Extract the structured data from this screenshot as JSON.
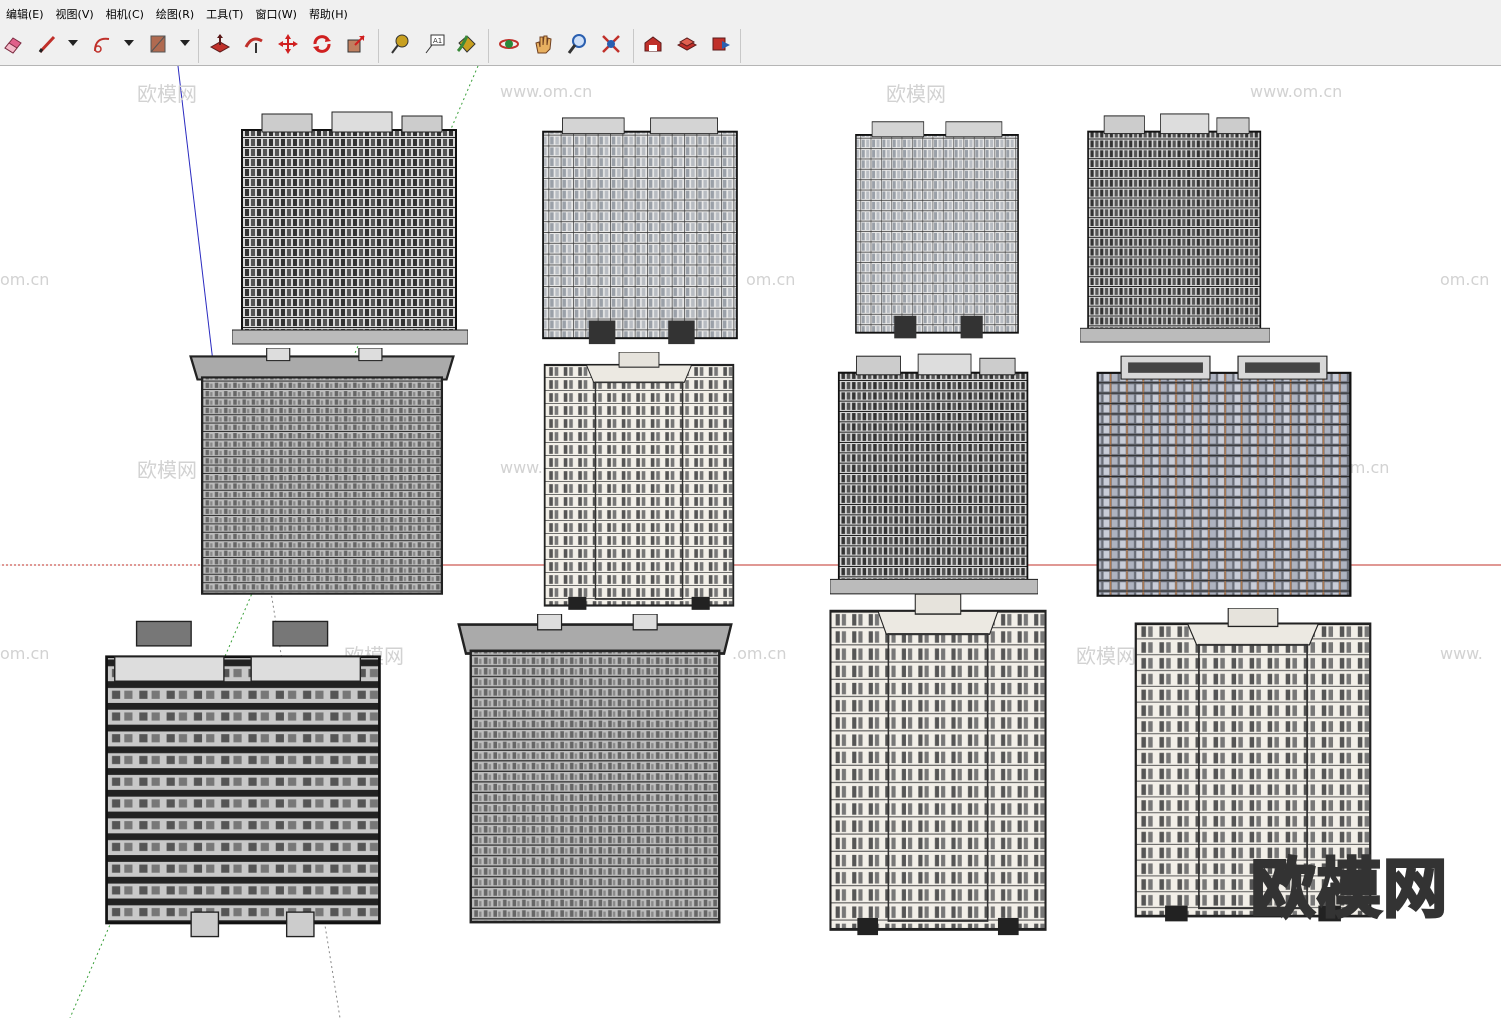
{
  "menubar": {
    "items": [
      "编辑(E)",
      "视图(V)",
      "相机(C)",
      "绘图(R)",
      "工具(T)",
      "窗口(W)",
      "帮助(H)"
    ]
  },
  "toolbar": {
    "buttons": [
      {
        "name": "eraser-tool",
        "icon": "eraser-icon",
        "color": "#e0608a"
      },
      {
        "name": "pencil-tool",
        "icon": "pencil-icon",
        "color": "#c0302a"
      },
      {
        "name": "arc-tool",
        "icon": "arc-icon",
        "color": "#c0302a"
      },
      {
        "name": "rectangle-tool",
        "icon": "rectangle-icon",
        "color": "#b06a50"
      },
      {
        "name": "push-pull-tool",
        "icon": "push-pull-icon",
        "color": "#c0302a"
      },
      {
        "name": "follow-me-tool",
        "icon": "follow-me-icon",
        "color": "#c0302a"
      },
      {
        "name": "move-tool",
        "icon": "move-icon",
        "color": "#d02020"
      },
      {
        "name": "rotate-tool",
        "icon": "rotate-icon",
        "color": "#d02020"
      },
      {
        "name": "scale-tool",
        "icon": "scale-icon",
        "color": "#d02020"
      },
      {
        "name": "tape-measure-tool",
        "icon": "tape-measure-icon",
        "color": "#c8a020"
      },
      {
        "name": "text-tool",
        "icon": "text-icon",
        "color": "#333333"
      },
      {
        "name": "paint-bucket-tool",
        "icon": "paint-bucket-icon",
        "color": "#3a8a3a"
      },
      {
        "name": "orbit-tool",
        "icon": "orbit-icon",
        "color": "#c0302a"
      },
      {
        "name": "pan-tool",
        "icon": "pan-icon",
        "color": "#e8b060"
      },
      {
        "name": "zoom-tool",
        "icon": "zoom-icon",
        "color": "#2a5fb0"
      },
      {
        "name": "zoom-extents-tool",
        "icon": "zoom-extents-icon",
        "color": "#c0302a"
      },
      {
        "name": "warehouse-tool",
        "icon": "warehouse-icon",
        "color": "#c0302a"
      },
      {
        "name": "components-tool",
        "icon": "components-icon",
        "color": "#c0302a"
      },
      {
        "name": "share-model-tool",
        "icon": "share-model-icon",
        "color": "#c0302a"
      }
    ]
  },
  "watermarks": {
    "brand": "欧模网",
    "url": "www.om.cn",
    "url_partial_left": "om.cn",
    "url_partial_right": "www.",
    "url_tail": ".om.cn",
    "url_tail_short": "om.cn"
  },
  "brand_watermark": "欧模网",
  "colors": {
    "axis_red": "#c0302a",
    "axis_green": "#3aa03a",
    "axis_blue": "#2a2ac0",
    "ui_bg": "#f0f0f0"
  }
}
